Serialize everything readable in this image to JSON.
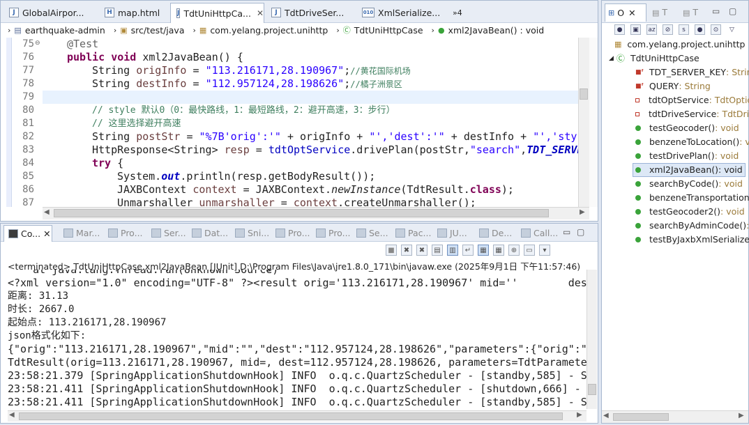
{
  "editor": {
    "tabs": [
      {
        "label": "GlobalAirpor...",
        "icon": "J",
        "active": false
      },
      {
        "label": "map.html",
        "icon": "H",
        "active": false
      },
      {
        "label": "TdtUniHttpCa...",
        "icon": "J",
        "active": true
      },
      {
        "label": "TdtDriveSer...",
        "icon": "J",
        "active": false
      },
      {
        "label": "XmlSerialize...",
        "icon": "010",
        "active": false
      }
    ],
    "overflow_label": "»4",
    "breadcrumb": [
      "earthquake-admin",
      "src/test/java",
      "com.yelang.project.unihttp",
      "TdtUniHttpCase",
      "xml2JavaBean() : void"
    ],
    "line_numbers": [
      "75",
      "76",
      "77",
      "78",
      "79",
      "80",
      "81",
      "82",
      "83",
      "84",
      "85",
      "86",
      "87"
    ],
    "code": {
      "l75": "@Test",
      "l76_kw1": "public",
      "l76_kw2": "void",
      "l76_rest": " xml2JavaBean() {",
      "l77_type": "String ",
      "l77_var": "origInfo",
      "l77_eq": " = ",
      "l77_str": "\"113.216171,28.190967\"",
      "l77_semi": ";",
      "l77_cm": "//黄花国际机场",
      "l78_type": "String ",
      "l78_var": "destInfo",
      "l78_eq": " = ",
      "l78_str": "\"112.957124,28.198626\"",
      "l78_semi": ";",
      "l78_cm": "//橘子洲景区",
      "l80_cm": "// style 默认0（0：最快路线，1：最短路线，2：避开高速，3：步行）",
      "l81_cm": "// 这里选择避开高速",
      "l82_type": "String ",
      "l82_var": "postStr",
      "l82_eq": " = ",
      "l82_s1": "\"%7B'orig':'\"",
      "l82_p1": " + origInfo + ",
      "l82_s2": "\"','dest':'\"",
      "l82_p2": " + destInfo + ",
      "l82_s3": "\"','sty",
      "l83_a": "HttpResponse<String> ",
      "l83_var": "resp",
      "l83_b": " = ",
      "l83_fld": "tdtOptService",
      "l83_c": ".drivePlan(postStr,",
      "l83_str": "\"search\"",
      "l83_d": ",",
      "l83_sf": "TDT_SERVE",
      "l84_kw": "try",
      "l84_rest": " {",
      "l85_a": "System.",
      "l85_out": "out",
      "l85_b": ".println(resp.getBodyResult());",
      "l86_a": "JAXBContext ",
      "l86_var": "context",
      "l86_b": " = JAXBContext.",
      "l86_m": "newInstance",
      "l86_c": "(TdtResult.",
      "l86_kw": "class",
      "l86_d": ");",
      "l87_a": "Unmarshaller ",
      "l87_var": "unmarshaller",
      "l87_b": " = ",
      "l87_c": "context",
      "l87_d": ".createUnmarshaller();"
    }
  },
  "console": {
    "tabs": [
      {
        "label": "Co...",
        "active": true
      },
      {
        "label": "Mar...",
        "active": false
      },
      {
        "label": "Pro...",
        "active": false
      },
      {
        "label": "Ser...",
        "active": false
      },
      {
        "label": "Dat...",
        "active": false
      },
      {
        "label": "Sni...",
        "active": false
      },
      {
        "label": "Pro...",
        "active": false
      },
      {
        "label": "Pro...",
        "active": false
      },
      {
        "label": "Se...",
        "active": false
      },
      {
        "label": "Pac...",
        "active": false
      },
      {
        "label": "JU...",
        "active": false
      },
      {
        "label": "De...",
        "active": false
      },
      {
        "label": "Call...",
        "active": false
      }
    ],
    "terminated": "<terminated> TdtUniHttpCase.xml2JavaBean [JUnit] D:\\Program Files\\Java\\jre1.8.0_171\\bin\\javaw.exe  (2025年9月1日 下午11:57:46)",
    "lines": [
      "    at java.lang.Thread.run(Unknown Source)",
      "<?xml version=\"1.0\" encoding=\"UTF-8\" ?><result orig='113.216171,28.190967' mid=''        des",
      "距离: 31.13",
      "时长: 2667.0",
      "起始点: 113.216171,28.190967",
      "json格式化如下:",
      "{\"orig\":\"113.216171,28.190967\",\"mid\":\"\",\"dest\":\"112.957124,28.198626\",\"parameters\":{\"orig\":\"",
      "TdtResult(orig=113.216171,28.190967, mid=, dest=112.957124,28.198626, parameters=TdtParamete",
      "23:58:21.379 [SpringApplicationShutdownHook] INFO  o.q.c.QuartzScheduler - [standby,585] - S",
      "23:58:21.411 [SpringApplicationShutdownHook] INFO  o.q.c.QuartzScheduler - [shutdown,666] - ",
      "23:58:21.411 [SpringApplicationShutdownHook] INFO  o.q.c.QuartzScheduler - [standby,585] - S"
    ]
  },
  "outline": {
    "tabs": [
      "O",
      "T",
      "T"
    ],
    "package": "com.yelang.project.unihttp",
    "class_name": "TdtUniHttpCase",
    "members": [
      {
        "name": "TDT_SERVER_KEY",
        "type": " : Strin",
        "kind": "static-field",
        "selected": false
      },
      {
        "name": "QUERY",
        "type": " : String",
        "kind": "static-field",
        "selected": false
      },
      {
        "name": "tdtOptService",
        "type": " : TdtOptio",
        "kind": "field",
        "selected": false
      },
      {
        "name": "tdtDriveService",
        "type": " : TdtDriv",
        "kind": "field",
        "selected": false
      },
      {
        "name": "testGeocoder()",
        "type": " : void",
        "kind": "method",
        "selected": false
      },
      {
        "name": "benzeneToLocation()",
        "type": " : v",
        "kind": "method",
        "selected": false
      },
      {
        "name": "testDrivePlan()",
        "type": " : void",
        "kind": "method",
        "selected": false
      },
      {
        "name": "xml2JavaBean()",
        "type": " : void",
        "kind": "method",
        "selected": true
      },
      {
        "name": "searchByCode()",
        "type": " : void",
        "kind": "method",
        "selected": false
      },
      {
        "name": "benzeneTransportation",
        "type": "",
        "kind": "method",
        "selected": false
      },
      {
        "name": "testGeocoder2()",
        "type": " : void",
        "kind": "method",
        "selected": false
      },
      {
        "name": "searchByAdminCode()",
        "type": " :",
        "kind": "method",
        "selected": false
      },
      {
        "name": "testByJaxbXmlSerializeC",
        "type": "",
        "kind": "method",
        "selected": false
      }
    ]
  },
  "colors": {
    "keyword": "#7f0055",
    "string": "#2a00ff",
    "comment": "#3f7f5f",
    "field": "#0000c0",
    "method_icon": "#3aa33a"
  }
}
